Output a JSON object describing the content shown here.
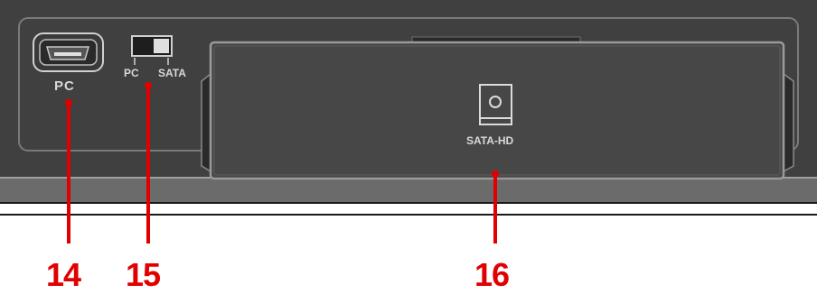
{
  "colors": {
    "panel": "#404040",
    "panel_dark": "#2f2f2f",
    "edge": "#8a8a8a",
    "callout": "#e00000",
    "label": "#d8d8d8"
  },
  "labels": {
    "usb_port": "PC",
    "switch_left": "PC",
    "switch_right": "SATA",
    "drive_bay": "SATA-HD"
  },
  "callouts": [
    {
      "number": "14",
      "target": "mini-usb-port"
    },
    {
      "number": "15",
      "target": "pc-sata-switch"
    },
    {
      "number": "16",
      "target": "sata-hd-bay"
    }
  ],
  "icons": {
    "usb_port": "mini-usb-port-icon",
    "switch": "slide-switch-icon",
    "drive": "hard-drive-icon"
  }
}
